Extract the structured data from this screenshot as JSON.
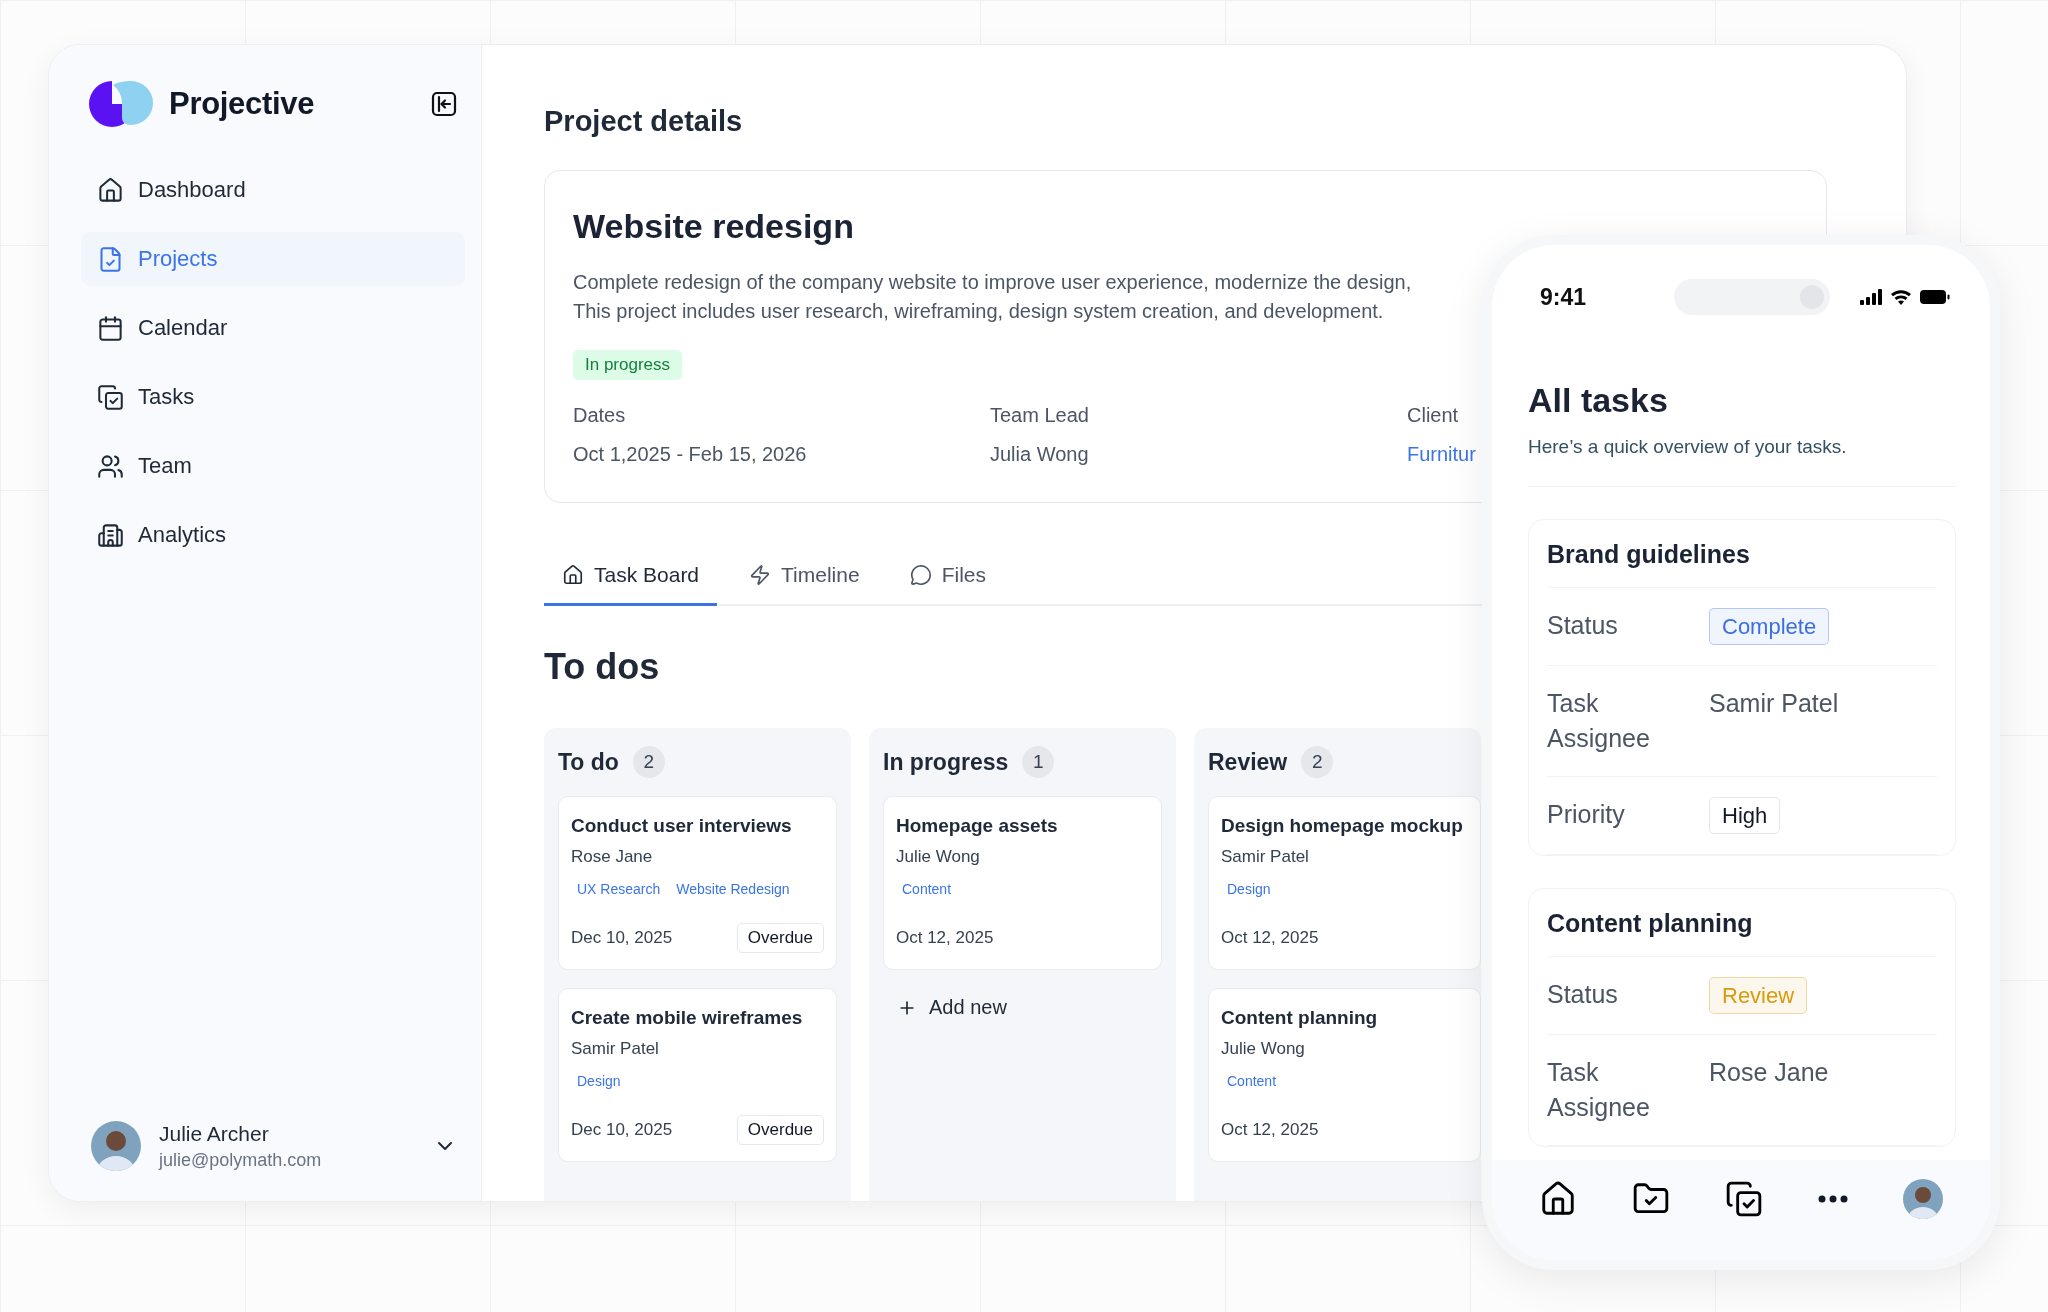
{
  "app": {
    "name": "Projective"
  },
  "sidebar": {
    "items": [
      {
        "label": "Dashboard",
        "selected": false
      },
      {
        "label": "Projects",
        "selected": true
      },
      {
        "label": "Calendar",
        "selected": false
      },
      {
        "label": "Tasks",
        "selected": false
      },
      {
        "label": "Team",
        "selected": false
      },
      {
        "label": "Analytics",
        "selected": false
      }
    ]
  },
  "user": {
    "name": "Julie Archer",
    "email": "julie@polymath.com"
  },
  "page": {
    "title": "Project details"
  },
  "project": {
    "title": "Website redesign",
    "description_lines": [
      "Complete redesign of the company website to improve user experience, modernize the design,",
      "This project includes user research, wireframing, design system creation, and development."
    ],
    "status": "In progress",
    "fields": [
      {
        "label": "Dates",
        "value": "Oct 1,2025 - Feb 15, 2026",
        "kind": "text"
      },
      {
        "label": "Team Lead",
        "value": "Julia Wong",
        "kind": "text"
      },
      {
        "label": "Client",
        "value": "Furnitur",
        "kind": "link"
      }
    ]
  },
  "tabs": [
    {
      "label": "Task Board",
      "selected": true
    },
    {
      "label": "Timeline",
      "selected": false
    },
    {
      "label": "Files",
      "selected": false
    }
  ],
  "board": {
    "title": "To dos",
    "columns": [
      {
        "title": "To do",
        "count": "2",
        "cards": [
          {
            "title": "Conduct user interviews",
            "assignee": "Rose Jane",
            "tags": [
              "UX Research",
              "Website Redesign"
            ],
            "date": "Dec 10, 2025",
            "flag": "Overdue"
          },
          {
            "title": "Create mobile wireframes",
            "assignee": "Samir Patel",
            "tags": [
              "Design"
            ],
            "date": "Dec 10, 2025",
            "flag": "Overdue"
          }
        ]
      },
      {
        "title": "In progress",
        "count": "1",
        "cards": [
          {
            "title": "Homepage assets",
            "assignee": "Julie Wong",
            "tags": [
              "Content"
            ],
            "date": "Oct 12, 2025"
          }
        ],
        "add_label": "Add new"
      },
      {
        "title": "Review",
        "count": "2",
        "cards": [
          {
            "title": "Design homepage mockup",
            "assignee": "Samir Patel",
            "tags": [
              "Design"
            ],
            "date": "Oct 12, 2025"
          },
          {
            "title": "Content planning",
            "assignee": "Julie Wong",
            "tags": [
              "Content"
            ],
            "date": "Oct 12, 2025"
          }
        ]
      }
    ]
  },
  "phone": {
    "time": "9:41",
    "title": "All tasks",
    "subtitle": "Here’s a quick overview of your tasks.",
    "tasks": [
      {
        "title": "Brand guidelines",
        "rows": [
          {
            "label": "Status",
            "value": "Complete",
            "kind": "status",
            "color": "#3b6fe0"
          },
          {
            "label": "Task Assignee",
            "value": "Samir Patel",
            "kind": "text"
          },
          {
            "label": "Priority",
            "value": "High",
            "kind": "chip"
          }
        ]
      },
      {
        "title": "Content planning",
        "rows": [
          {
            "label": "Status",
            "value": "Review",
            "kind": "status",
            "color": "#d99a0b"
          },
          {
            "label": "Task Assignee",
            "value": "Rose Jane",
            "kind": "text"
          }
        ]
      }
    ]
  }
}
